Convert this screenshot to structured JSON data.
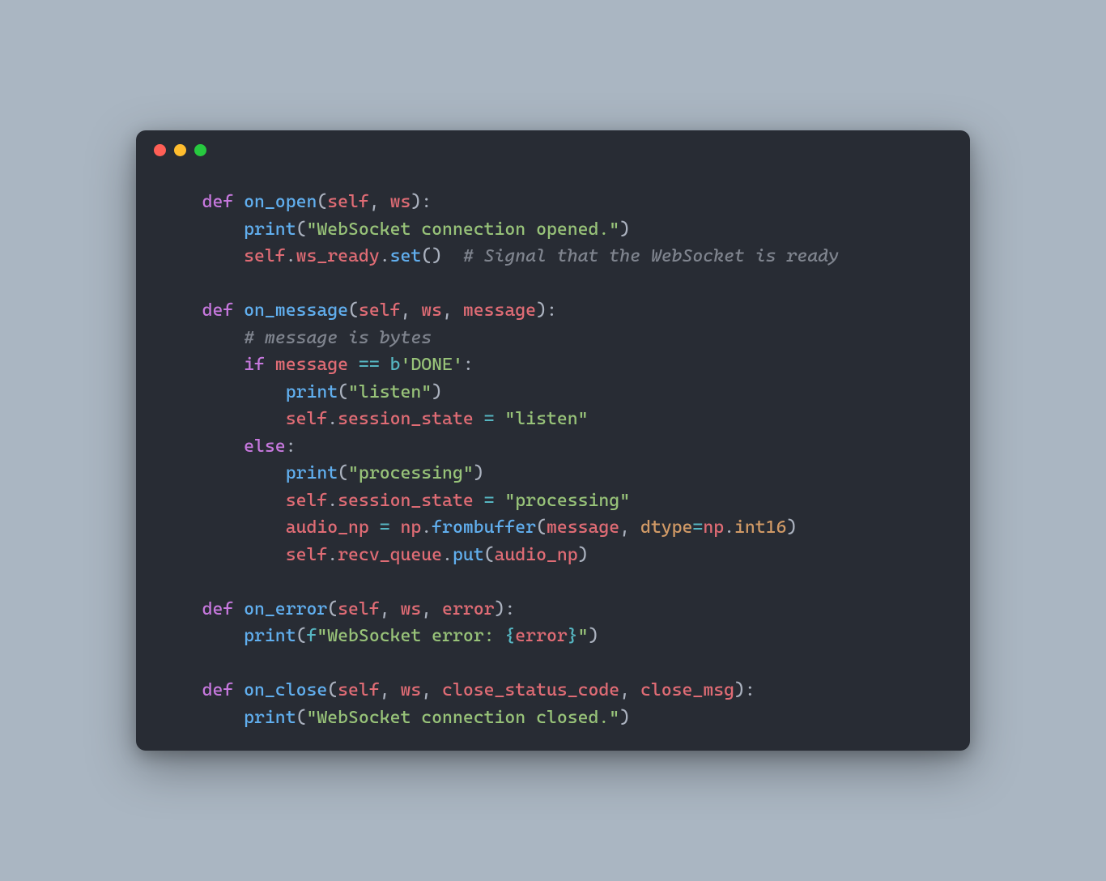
{
  "window": {
    "traffic_lights": [
      "close",
      "minimize",
      "zoom"
    ]
  },
  "code": {
    "fn_on_open": {
      "def": "def",
      "name": "on_open",
      "params": {
        "self": "self",
        "ws": "ws"
      },
      "body": {
        "print": "print",
        "str_opened": "\"WebSocket connection opened.\"",
        "self": "self",
        "ws_ready": "ws_ready",
        "set": "set",
        "comment": "# Signal that the WebSocket is ready"
      }
    },
    "fn_on_message": {
      "def": "def",
      "name": "on_message",
      "params": {
        "self": "self",
        "ws": "ws",
        "message": "message"
      },
      "body": {
        "comment_bytes": "# message is bytes",
        "kw_if": "if",
        "message": "message",
        "eq": "==",
        "b_prefix": "b",
        "str_done": "'DONE'",
        "print": "print",
        "str_listen": "\"listen\"",
        "self": "self",
        "session_state": "session_state",
        "assign": "=",
        "str_listen2": "\"listen\"",
        "kw_else": "else",
        "str_processing": "\"processing\"",
        "str_processing2": "\"processing\"",
        "audio_np": "audio_np",
        "np": "np",
        "frombuffer": "frombuffer",
        "dtype": "dtype",
        "int16": "int16",
        "recv_queue": "recv_queue",
        "put": "put"
      }
    },
    "fn_on_error": {
      "def": "def",
      "name": "on_error",
      "params": {
        "self": "self",
        "ws": "ws",
        "error": "error"
      },
      "body": {
        "print": "print",
        "f_prefix": "f",
        "str_head": "\"WebSocket error: ",
        "lbrace": "{",
        "error": "error",
        "rbrace": "}",
        "str_tail": "\""
      }
    },
    "fn_on_close": {
      "def": "def",
      "name": "on_close",
      "params": {
        "self": "self",
        "ws": "ws",
        "csc": "close_status_code",
        "cmsg": "close_msg"
      },
      "body": {
        "print": "print",
        "str_closed": "\"WebSocket connection closed.\""
      }
    }
  }
}
